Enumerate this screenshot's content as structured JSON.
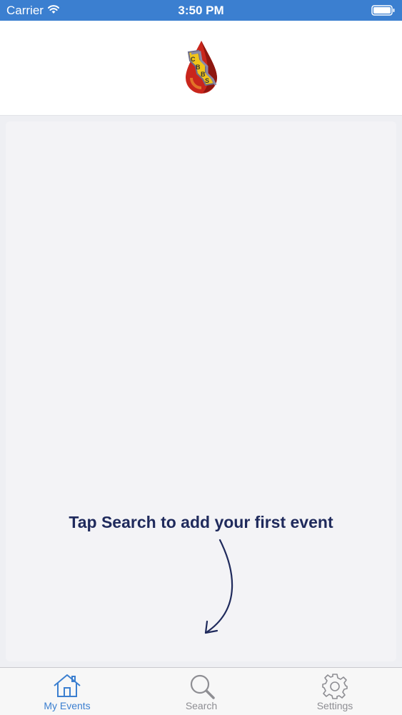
{
  "status_bar": {
    "carrier": "Carrier",
    "time": "3:50 PM",
    "wifi_icon": "wifi-icon",
    "battery_icon": "battery-icon"
  },
  "header": {
    "logo_text": "CBBS",
    "logo_icon": "blood-drop-logo"
  },
  "main": {
    "hint": "Tap Search to add your first event",
    "arrow_icon": "curved-arrow-icon"
  },
  "tab_bar": {
    "tabs": [
      {
        "label": "My Events",
        "icon": "house-icon",
        "active": true
      },
      {
        "label": "Search",
        "icon": "search-icon",
        "active": false
      },
      {
        "label": "Settings",
        "icon": "gear-icon",
        "active": false
      }
    ]
  },
  "colors": {
    "status_bar": "#3b7fd0",
    "active_tab": "#3b7fd0",
    "inactive_tab": "#8e8e93",
    "hint_text": "#1f2a5c",
    "content_bg": "#eeeff3"
  }
}
